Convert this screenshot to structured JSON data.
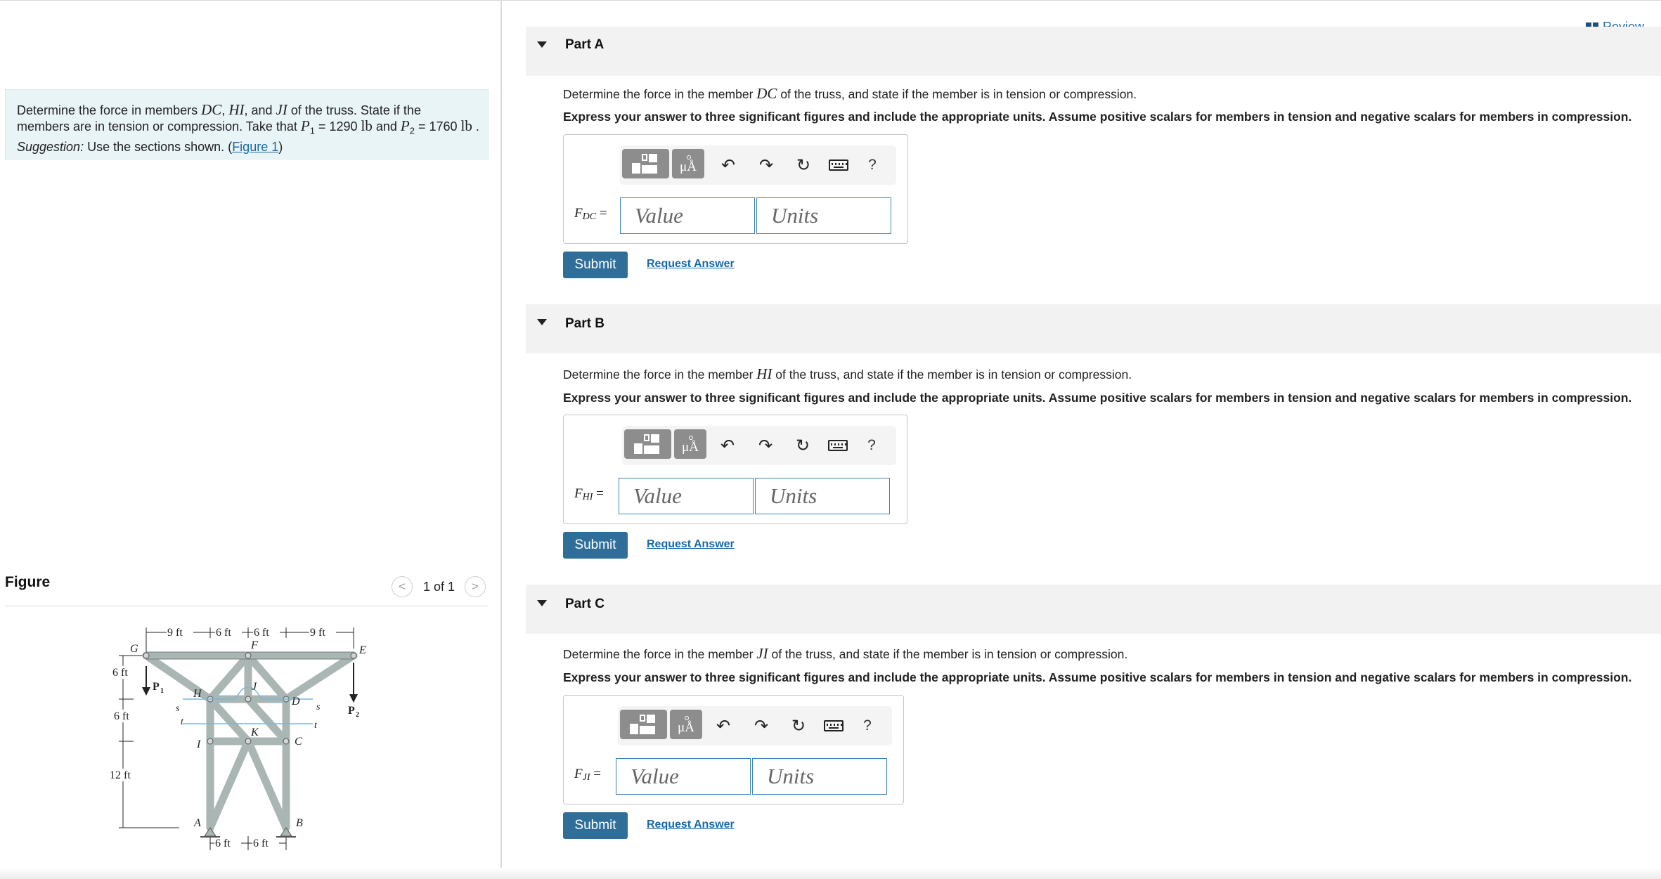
{
  "problem": {
    "line1_pre": "Determine the force in members ",
    "m1": "DC",
    "sep1": ", ",
    "m2": "HI",
    "sep2": ", and ",
    "m3": "JI",
    "line1_post": " of the truss. State if the",
    "line2_pre": "members are in tension or compression. Take that ",
    "p1_sym": "P",
    "p1_sub": "1",
    "p1_eq": " = 1290 ",
    "p1_unit": "lb",
    "and": " and ",
    "p2_sym": "P",
    "p2_sub": "2",
    "p2_eq": " = 1760 ",
    "p2_unit": "lb",
    "period": " .",
    "suggestion_label": "Suggestion:",
    "suggestion_text": " Use the sections shown. (",
    "figure_link": "Figure 1",
    "close_paren": ")"
  },
  "figure": {
    "title": "Figure",
    "prev": "<",
    "next": ">",
    "count": "1 of 1",
    "dims_top": [
      "9 ft",
      "6 ft",
      "6 ft",
      "9 ft"
    ],
    "dims_left": [
      "6 ft",
      "6 ft",
      "12 ft"
    ],
    "dims_bottom": [
      "6 ft",
      "6 ft"
    ],
    "nodes": [
      "G",
      "F",
      "E",
      "H",
      "J",
      "D",
      "I",
      "K",
      "C",
      "A",
      "B"
    ],
    "section_labels": [
      "s",
      "t",
      "s",
      "t"
    ],
    "loads": [
      "P",
      "1",
      "P",
      "2"
    ]
  },
  "review": {
    "label": "Review"
  },
  "parts": [
    {
      "title": "Part A",
      "q_pre": "Determine the force in the member ",
      "member": "DC",
      "q_post": " of the truss, and state if the member is in tension or compression.",
      "instructions": "Express your answer to three significant figures and include the appropriate units. Assume positive scalars for members in tension and negative scalars for members in compression.",
      "var_main": "F",
      "var_sub": "DC",
      "eq": " =",
      "value_placeholder": "Value",
      "units_placeholder": "Units",
      "submit": "Submit",
      "request": "Request Answer"
    },
    {
      "title": "Part B",
      "q_pre": "Determine the force in the member ",
      "member": "HI",
      "q_post": " of the truss, and state if the member is in tension or compression.",
      "instructions": "Express your answer to three significant figures and include the appropriate units. Assume positive scalars for members in tension and negative scalars for members in compression.",
      "var_main": "F",
      "var_sub": "HI",
      "eq": " =",
      "value_placeholder": "Value",
      "units_placeholder": "Units",
      "submit": "Submit",
      "request": "Request Answer"
    },
    {
      "title": "Part C",
      "q_pre": "Determine the force in the member ",
      "member": "JI",
      "q_post": " of the truss, and state if the member is in tension or compression.",
      "instructions": "Express your answer to three significant figures and include the appropriate units. Assume positive scalars for members in tension and negative scalars for members in compression.",
      "var_main": "F",
      "var_sub": "JI",
      "eq": " =",
      "value_placeholder": "Value",
      "units_placeholder": "Units",
      "submit": "Submit",
      "request": "Request Answer"
    }
  ],
  "toolbar": {
    "template_icon": "templates-icon",
    "units_icon_text": "μÅ",
    "undo": "↶",
    "redo": "↷",
    "reset": "↻",
    "keyboard_icon": "keyboard-icon",
    "help": "?"
  },
  "colors": {
    "accent": "#2f6e99",
    "link": "#1869a8",
    "input_border": "#3d82b8",
    "problem_bg": "#e9f4f7",
    "part_header_bg": "#f2f2f2",
    "truss_member": "#a9b6b3"
  }
}
